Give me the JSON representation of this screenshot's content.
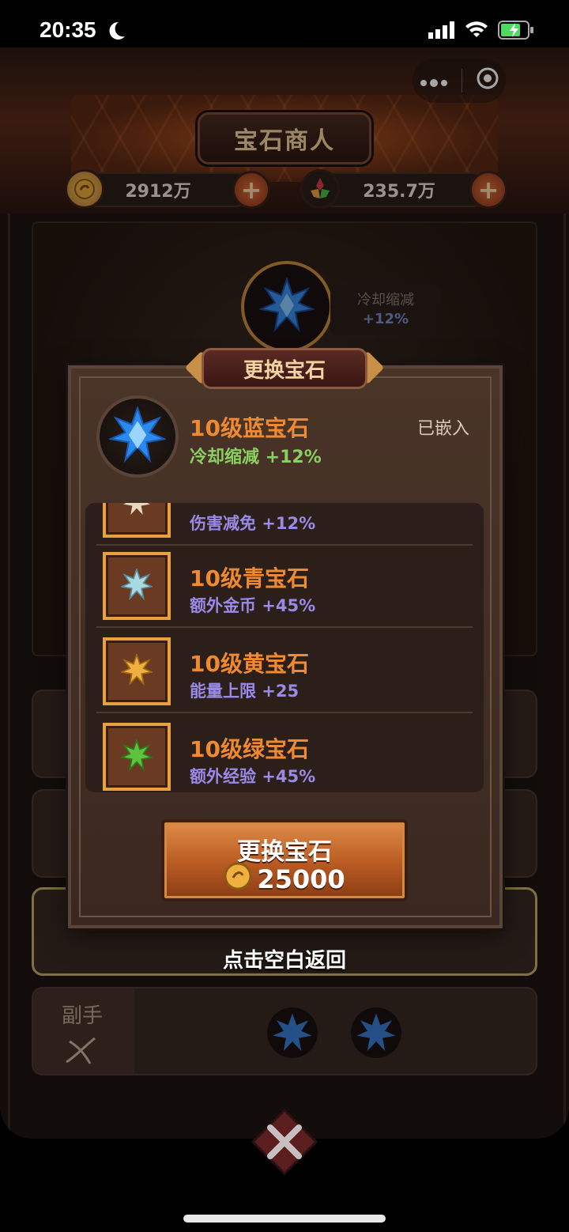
{
  "status": {
    "time": "20:35"
  },
  "header": {
    "title": "宝石商人",
    "gold": "2912万",
    "energy": "235.7万"
  },
  "background": {
    "tip_line1": "冷却缩减",
    "tip_line2": "+12%",
    "slot_sub": "副手"
  },
  "modal": {
    "tab": "更换宝石",
    "current": {
      "name": "10级蓝宝石",
      "effect": "冷却缩减 +12%",
      "status": "已嵌入"
    },
    "items": [
      {
        "name": "",
        "effect": "伤害减免 +12%",
        "color": "#e8d8c0"
      },
      {
        "name": "10级青宝石",
        "effect": "额外金币 +45%",
        "color": "#a8d8e0"
      },
      {
        "name": "10级黄宝石",
        "effect": "能量上限 +25",
        "color": "#f0b040"
      },
      {
        "name": "10级绿宝石",
        "effect": "额外经验 +45%",
        "color": "#60c040"
      }
    ],
    "button": {
      "label": "更换宝石",
      "price": "25000"
    },
    "hint": "点击空白返回"
  },
  "colors": {
    "accent": "#f08a30",
    "effect_green": "#8ad060",
    "effect_purple": "#9a8ae8"
  }
}
